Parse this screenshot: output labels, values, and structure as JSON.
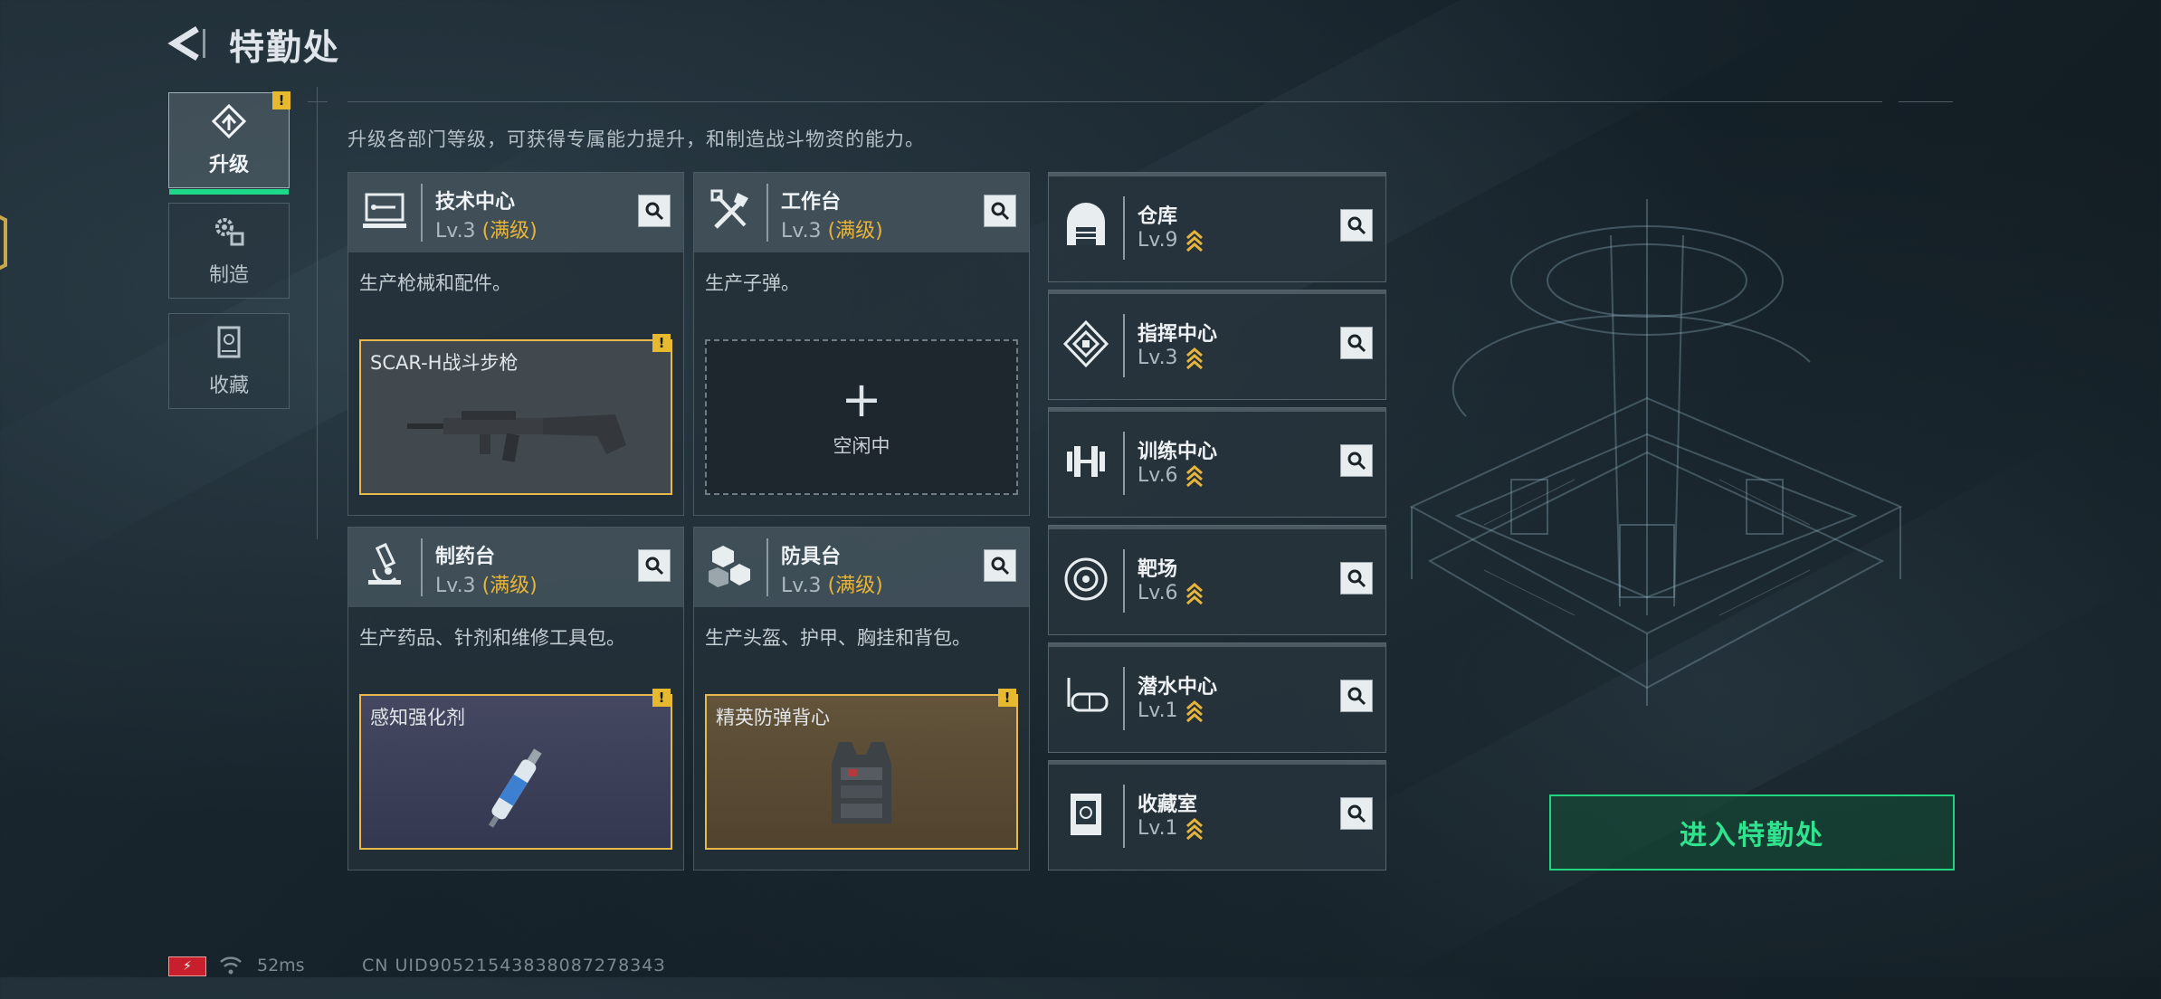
{
  "header": {
    "title": "特勤处"
  },
  "tabs": [
    {
      "label": "升级",
      "icon": "upgrade-icon",
      "active": true,
      "alert": "!"
    },
    {
      "label": "制造",
      "icon": "gears-icon",
      "active": false
    },
    {
      "label": "收藏",
      "icon": "trophy-case-icon",
      "active": false
    }
  ],
  "description": "升级各部门等级，可获得专属能力提升，和制造战斗物资的能力。",
  "departments": [
    {
      "name": "技术中心",
      "level_prefix": "Lv.3",
      "level_suffix": "(满级)",
      "icon": "computer-icon",
      "desc": "生产枪械和配件。",
      "slot": {
        "state": "producing",
        "title": "SCAR-H战斗步枪",
        "alert": "!"
      }
    },
    {
      "name": "工作台",
      "level_prefix": "Lv.3",
      "level_suffix": "(满级)",
      "icon": "tools-icon",
      "desc": "生产子弹。",
      "slot": {
        "state": "idle",
        "plus": "+",
        "label": "空闲中"
      }
    },
    {
      "name": "制药台",
      "level_prefix": "Lv.3",
      "level_suffix": "(满级)",
      "icon": "microscope-icon",
      "desc": "生产药品、针剂和维修工具包。",
      "slot": {
        "state": "producing",
        "title": "感知强化剂",
        "alert": "!"
      }
    },
    {
      "name": "防具台",
      "level_prefix": "Lv.3",
      "level_suffix": "(满级)",
      "icon": "armor-blocks-icon",
      "desc": "生产头盔、护甲、胸挂和背包。",
      "slot": {
        "state": "producing",
        "title": "精英防弹背心",
        "alert": "!"
      }
    }
  ],
  "facilities": [
    {
      "name": "仓库",
      "level": "Lv.9",
      "icon": "warehouse-icon"
    },
    {
      "name": "指挥中心",
      "level": "Lv.3",
      "icon": "command-center-icon"
    },
    {
      "name": "训练中心",
      "level": "Lv.6",
      "icon": "dumbbell-icon"
    },
    {
      "name": "靶场",
      "level": "Lv.6",
      "icon": "target-icon"
    },
    {
      "name": "潜水中心",
      "level": "Lv.1",
      "icon": "diving-mask-icon"
    },
    {
      "name": "收藏室",
      "level": "Lv.1",
      "icon": "collection-room-icon"
    }
  ],
  "enter_button": "进入特勤处",
  "status_bar": {
    "ping": "52ms",
    "uid": "CN UID9052154383808727834З"
  },
  "colors": {
    "accent_green": "#1fd98a",
    "gold": "#e8b53a",
    "alert_yellow": "#e6b92e"
  }
}
